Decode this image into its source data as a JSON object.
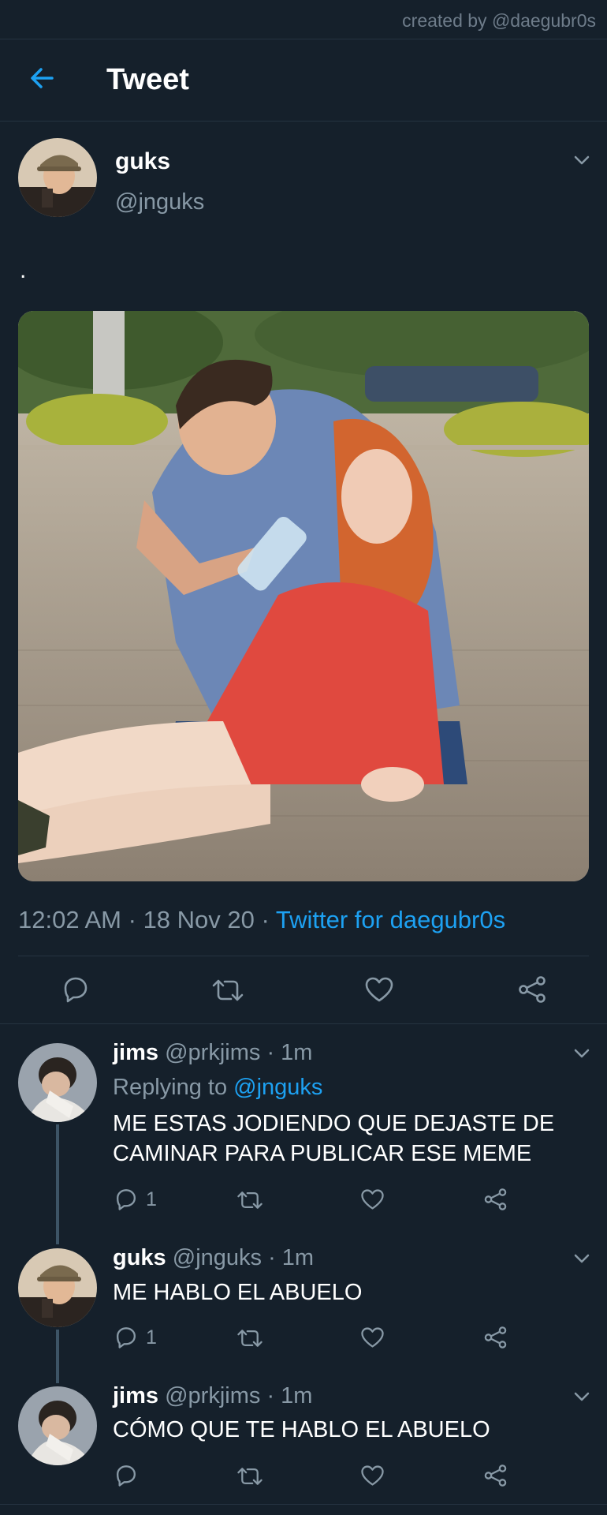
{
  "watermark": "created by @daegubr0s",
  "header": {
    "title": "Tweet"
  },
  "tweet": {
    "name": "guks",
    "handle": "@jnguks",
    "text": ".",
    "time": "12:02 AM",
    "sep1": "·",
    "date": "18 Nov 20",
    "sep2": "·",
    "source": "Twitter for daegubr0s"
  },
  "replies": [
    {
      "name": "jims",
      "handle": "@prkjims",
      "time": "· 1m",
      "replying_prefix": "Replying to",
      "replying_to": "@jnguks",
      "text": "ME ESTAS JODIENDO QUE DEJASTE DE CAMINAR PARA PUBLICAR ESE MEME",
      "reply_count": "1"
    },
    {
      "name": "guks",
      "handle": "@jnguks",
      "time": "· 1m",
      "text": "ME HABLO EL ABUELO",
      "reply_count": "1"
    },
    {
      "name": "jims",
      "handle": "@prkjims",
      "time": "· 1m",
      "text": "CÓMO QUE TE HABLO EL ABUELO",
      "reply_count": ""
    }
  ],
  "colors": {
    "background": "#15202b",
    "accent": "#1da1f2",
    "muted": "#8899a6",
    "divider": "#253341"
  },
  "icons": {
    "back": "arrow-left-icon",
    "caret": "chevron-down-icon",
    "reply": "reply-icon",
    "retweet": "retweet-icon",
    "like": "heart-icon",
    "share": "share-icon"
  }
}
